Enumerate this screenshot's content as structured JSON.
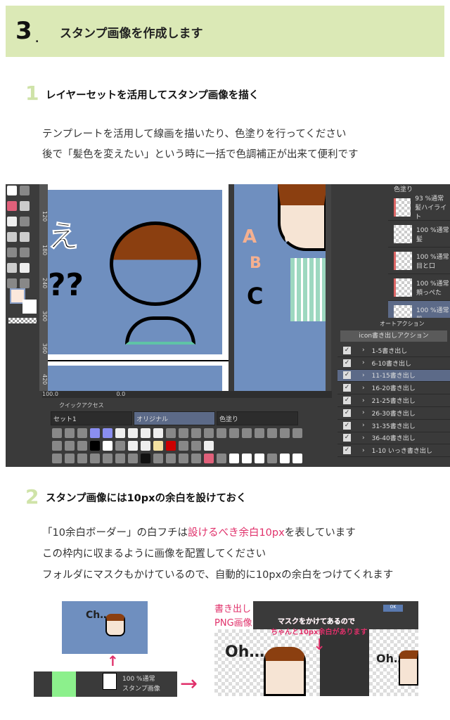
{
  "header": {
    "number": "3",
    "dot": ".",
    "title": "スタンプ画像を作成します",
    "bg_color": "#dbe9b6"
  },
  "step1": {
    "number": "1",
    "title": "レイヤーセットを活用してスタンプ画像を描く",
    "lines": [
      "テンプレートを活用して線画を描いたり、色塗りを行ってください",
      "後で「髪色を変えたい」という時に一括で色調補正が出来て便利です"
    ]
  },
  "screenshot1": {
    "ruler_ticks": [
      "120",
      "180",
      "240",
      "300",
      "360",
      "420"
    ],
    "canvas_text": [
      "え",
      "??",
      "A",
      "B",
      "C"
    ],
    "zoom_value": "100.0",
    "rotate_value": "0.0",
    "layers": {
      "folder": "色塗り",
      "items": [
        {
          "mode": "93 %通常",
          "name": "髪ハイライト"
        },
        {
          "mode": "100 %通常",
          "name": "髪"
        },
        {
          "mode": "100 %通常",
          "name": "目と口"
        },
        {
          "mode": "100 %通常",
          "name": "頬っぺた"
        },
        {
          "mode": "100 %通常",
          "name": "肌"
        }
      ]
    },
    "auto_action": {
      "tab": "オートアクション",
      "set": "icon書き出しアクション",
      "items": [
        "1-5書き出し",
        "6-10書き出し",
        "11-15書き出し",
        "16-20書き出し",
        "21-25書き出し",
        "26-30書き出し",
        "31-35書き出し",
        "36-40書き出し",
        "1-10 いっき書き出し"
      ],
      "selected_index": 2
    },
    "quick_access": {
      "title": "クイックアクセス",
      "tabs": [
        "セット1",
        "オリジナル",
        "色塗り"
      ],
      "active_tab": 1
    }
  },
  "step2": {
    "number": "2",
    "title": "スタンプ画像には10pxの余白を設けておく",
    "line1_pre": "「10余白ボーダー」の白フチは",
    "line1_highlight": "設けるべき余白10px",
    "line1_post": "を表しています",
    "line2": "この枠内に収まるように画像を配置してください",
    "line3": "フォルダにマスクもかけているので、自動的に10pxの余白をつけてくれます",
    "highlight_color": "#e0306a"
  },
  "screenshot2": {
    "small_text": "Ch…",
    "layer": {
      "mode": "100 %通常",
      "name": "スタンプ画像"
    },
    "export_label_1": "書き出し",
    "export_label_2": "PNG画像",
    "note_1": "マスクをかけてあるので",
    "note_2": "ちゃんと10px余白があります",
    "oh_text": "Oh…",
    "ok_button": "OK"
  }
}
